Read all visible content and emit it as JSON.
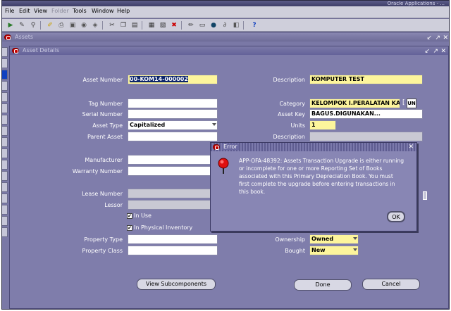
{
  "titlebar": {
    "text": "Oracle Applications - ..."
  },
  "menu": [
    {
      "label": "File",
      "disabled": false
    },
    {
      "label": "Edit",
      "disabled": false
    },
    {
      "label": "View",
      "disabled": false
    },
    {
      "label": "Folder",
      "disabled": true
    },
    {
      "label": "Tools",
      "disabled": false
    },
    {
      "label": "Window",
      "disabled": false
    },
    {
      "label": "Help",
      "disabled": false
    }
  ],
  "toolbar_icons": [
    "new-icon",
    "find-icon",
    "navigator-icon",
    "save-icon",
    "print-icon",
    "close-form-icon",
    "cut-icon",
    "copy-icon",
    "paste-icon",
    "clear-record-icon",
    "delete-icon",
    "edit-field-icon",
    "zoom-icon",
    "translations-icon",
    "attachments-icon",
    "folder-tools-icon",
    "help-icon"
  ],
  "outer_window": {
    "title": "Assets"
  },
  "inner_window": {
    "title": "Asset Details"
  },
  "form": {
    "asset_number_label": "Asset Number",
    "asset_number_value": "00-KOM14-000002",
    "tag_number_label": "Tag Number",
    "serial_number_label": "Serial Number",
    "asset_type_label": "Asset Type",
    "asset_type_value": "Capitalized",
    "parent_asset_label": "Parent Asset",
    "manufacturer_label": "Manufacturer",
    "warranty_number_label": "Warranty Number",
    "lease_number_label": "Lease Number",
    "lessor_label": "Lessor",
    "in_use_label": "In Use",
    "in_physical_inventory_label": "In Physical Inventory",
    "property_type_label": "Property Type",
    "property_class_label": "Property Class",
    "description_label": "Description",
    "description_value": "KOMPUTER TEST",
    "category_label": "Category",
    "category_value": "KELOMPOK I.PERALATAN KA",
    "category_button": "UN",
    "asset_key_label": "Asset Key",
    "asset_key_value": "BAGUS.DIGUNAKAN...",
    "units_label": "Units",
    "units_value": "1",
    "description2_label": "Description",
    "ownership_label": "Ownership",
    "ownership_value": "Owned",
    "bought_label": "Bought",
    "bought_value": "New"
  },
  "buttons": {
    "view_subcomponents": "View Subcomponents",
    "done": "Done",
    "cancel": "Cancel"
  },
  "dialog": {
    "title": "Error",
    "message_lines": [
      "APP-OFA-48392: Assets Transaction Upgrade is either running",
      "or incomplete for one or more Reporting Set of Books",
      "associated with this Primary Depreciation Book.   You must",
      "first complete the upgrade before entering transactions in",
      "this book."
    ],
    "ok_label": "OK"
  }
}
